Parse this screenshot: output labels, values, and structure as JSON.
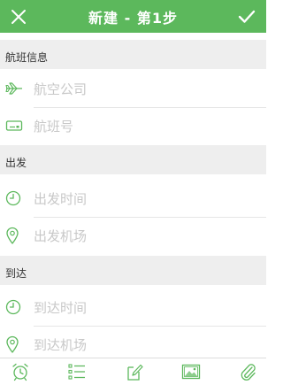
{
  "header": {
    "title": "新建 - 第1步",
    "close_icon": "close-icon",
    "confirm_icon": "check-icon",
    "background_color": "#5cb85c"
  },
  "sections": {
    "flight_info": {
      "title": "航班信息",
      "airline_placeholder": "航空公司",
      "flight_number_placeholder": "航班号"
    },
    "departure": {
      "title": "出发",
      "time_placeholder": "出发时间",
      "airport_placeholder": "出发机场"
    },
    "arrival": {
      "title": "到达",
      "time_placeholder": "到达时间",
      "airport_placeholder": "到达机场"
    }
  },
  "toolbar": {
    "items": [
      "alarm-clock-icon",
      "list-icon",
      "edit-note-icon",
      "image-icon",
      "attachment-icon"
    ]
  },
  "colors": {
    "accent": "#5cb85c",
    "placeholder": "#c8c8c8",
    "section_bg": "#eeeeee"
  }
}
